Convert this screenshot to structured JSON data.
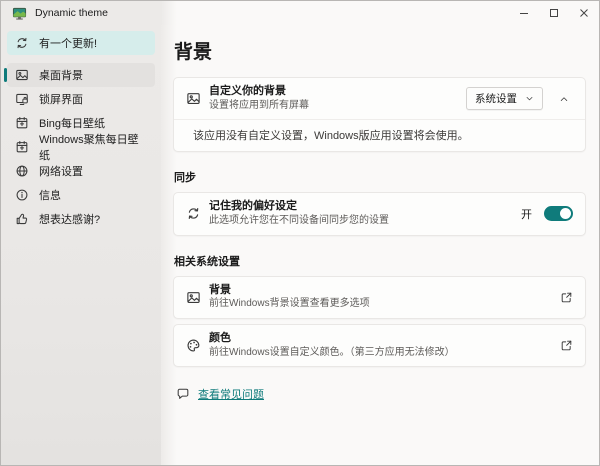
{
  "window": {
    "title": "Dynamic theme",
    "controls": {
      "minimize": "minimize",
      "maximize": "maximize",
      "close": "close"
    }
  },
  "colors": {
    "accent_teal": "#0f7b7b",
    "update_highlight": "#d6edeb",
    "sidebar_bg": "#eceae8",
    "content_bg": "#faf9f8"
  },
  "sidebar": {
    "update_item": {
      "label": "有一个更新!",
      "icon": "sync-icon"
    },
    "items": [
      {
        "label": "桌面背景",
        "icon": "image-icon",
        "selected": true
      },
      {
        "label": "锁屏界面",
        "icon": "lockscreen-icon",
        "selected": false
      },
      {
        "label": "Bing每日壁纸",
        "icon": "calendar-icon",
        "selected": false
      },
      {
        "label": "Windows聚焦每日壁纸",
        "icon": "calendar-icon",
        "selected": false
      },
      {
        "label": "网络设置",
        "icon": "globe-icon",
        "selected": false
      },
      {
        "label": "信息",
        "icon": "info-icon",
        "selected": false
      },
      {
        "label": "想表达感谢?",
        "icon": "thumbsup-icon",
        "selected": false
      }
    ]
  },
  "main": {
    "page_title": "背景",
    "customize_card": {
      "icon": "image-icon",
      "title": "自定义你的背景",
      "subtitle": "设置将应用到所有屏幕",
      "dropdown_value": "系统设置",
      "expander_state": "expanded",
      "expanded_note": "该应用没有自定义设置，Windows版应用设置将会使用。"
    },
    "sync_section": {
      "header": "同步",
      "card": {
        "icon": "sync-icon",
        "title": "记住我的偏好设定",
        "subtitle": "此选项允许您在不同设备间同步您的设置",
        "toggle_state_label": "开",
        "toggle_on": true
      }
    },
    "related_section": {
      "header": "相关系统设置",
      "cards": [
        {
          "icon": "image-icon",
          "title": "背景",
          "subtitle": "前往Windows背景设置查看更多选项",
          "action": "open-external"
        },
        {
          "icon": "palette-icon",
          "title": "颜色",
          "subtitle": "前往Windows设置自定义颜色。（第三方应用无法修改）",
          "action": "open-external"
        }
      ]
    },
    "faq_link": "查看常见问题"
  }
}
